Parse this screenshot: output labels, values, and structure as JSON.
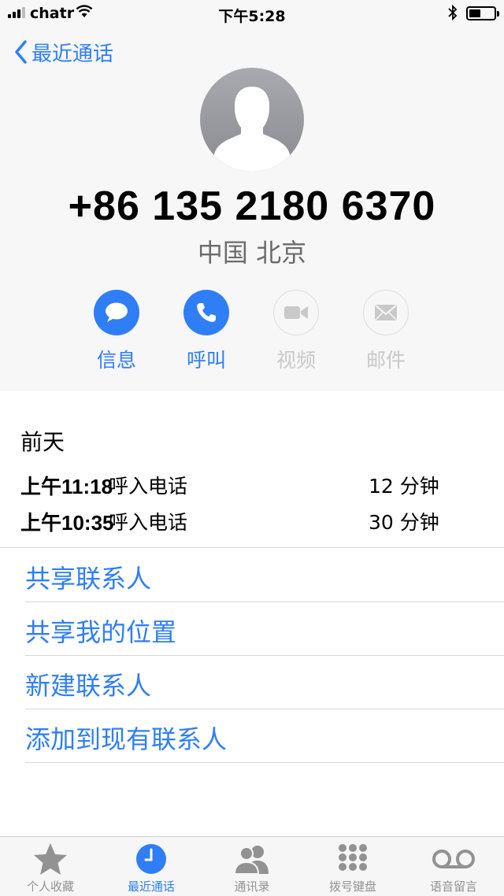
{
  "status_bar": {
    "carrier": "chatr",
    "time": "下午5:28"
  },
  "nav": {
    "back_label": "最近通话"
  },
  "contact": {
    "phone_number": "+86 135 2180 6370",
    "location": "中国 北京"
  },
  "actions": [
    {
      "label": "信息",
      "icon": "message-icon",
      "enabled": true
    },
    {
      "label": "呼叫",
      "icon": "phone-icon",
      "enabled": true
    },
    {
      "label": "视频",
      "icon": "video-icon",
      "enabled": false
    },
    {
      "label": "邮件",
      "icon": "mail-icon",
      "enabled": false
    }
  ],
  "recent_calls": {
    "day": "前天",
    "calls": [
      {
        "time": "上午11:18",
        "type": "呼入电话",
        "duration": "12 分钟"
      },
      {
        "time": "上午10:35",
        "type": "呼入电话",
        "duration": "30 分钟"
      }
    ]
  },
  "menu": [
    {
      "label": "共享联系人"
    },
    {
      "label": "共享我的位置"
    },
    {
      "label": "新建联系人"
    },
    {
      "label": "添加到现有联系人"
    }
  ],
  "tab_bar": [
    {
      "label": "个人收藏",
      "icon": "star-icon",
      "selected": false
    },
    {
      "label": "最近通话",
      "icon": "clock-icon",
      "selected": true
    },
    {
      "label": "通讯录",
      "icon": "contacts-icon",
      "selected": false
    },
    {
      "label": "拨号键盘",
      "icon": "keypad-icon",
      "selected": false
    },
    {
      "label": "语音留言",
      "icon": "voicemail-icon",
      "selected": false
    }
  ],
  "colors": {
    "accent": "#2f7ef6",
    "disabled": "#c9c9c9",
    "tab_inactive": "#929292"
  }
}
